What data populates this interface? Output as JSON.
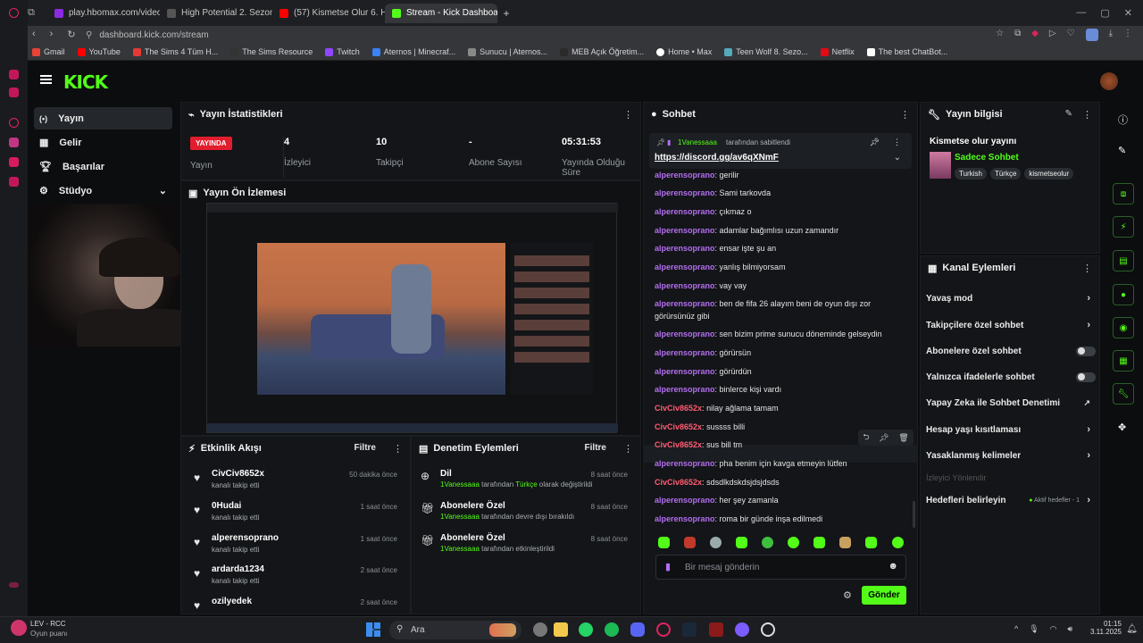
{
  "browser": {
    "tabs": [
      {
        "label": "play.hbomax.com/video/u",
        "color": "#8a2be2"
      },
      {
        "label": "High Potential 2. Sezon 7",
        "color": "#555"
      },
      {
        "label": "(57) Kismetse Olur 6. Ha",
        "color": "#ff0000"
      },
      {
        "label": "Stream - Kick Dashboard",
        "color": "#53fc18"
      }
    ],
    "url": "dashboard.kick.com/stream",
    "bookmarks": [
      "Gmail",
      "YouTube",
      "The Sims 4 Tüm H...",
      "The Sims Resource",
      "Twitch",
      "Aternos | Minecraf...",
      "Sunucu | Aternos...",
      "MEB Açık Öğretim...",
      "Home • Max",
      "Teen Wolf 8. Sezo...",
      "Netflix",
      "The best ChatBot..."
    ]
  },
  "kick": {
    "logo": "KICK",
    "nav": [
      {
        "label": "Yayın",
        "icon": "broadcast-icon"
      },
      {
        "label": "Gelir",
        "icon": "revenue-icon"
      },
      {
        "label": "Başarılar",
        "icon": "trophy-icon"
      },
      {
        "label": "Stüdyo",
        "icon": "studio-icon"
      }
    ]
  },
  "stats": {
    "title": "Yayın İstatistikleri",
    "live_badge": "YAYINDA",
    "live_label": "Yayın",
    "items": [
      {
        "value": "4",
        "label": "İzleyici"
      },
      {
        "value": "10",
        "label": "Takipçi"
      },
      {
        "value": "-",
        "label": "Abone Sayısı"
      },
      {
        "value": "05:31:53",
        "label": "Yayında Olduğu Süre"
      }
    ]
  },
  "preview": {
    "title": "Yayın Ön İzlemesi"
  },
  "activity": {
    "title": "Etkinlik Akışı",
    "filter": "Filtre",
    "items": [
      {
        "name": "CivCiv8652x",
        "sub": "kanalı takip etti",
        "time": "50 dakika önce"
      },
      {
        "name": "0Hudai",
        "sub": "kanalı takip etti",
        "time": "1 saat önce"
      },
      {
        "name": "alperensoprano",
        "sub": "kanalı takip etti",
        "time": "1 saat önce"
      },
      {
        "name": "ardarda1234",
        "sub": "kanalı takip etti",
        "time": "2 saat önce"
      },
      {
        "name": "ozilyedek",
        "sub": "",
        "time": "2 saat önce"
      }
    ]
  },
  "moderation": {
    "title": "Denetim Eylemleri",
    "filter": "Filtre",
    "items": [
      {
        "name": "Dil",
        "user": "1Vanessaaa",
        "mid": "tarafından",
        "hl": "Türkçe",
        "rest": "olarak değiştirildi",
        "time": "8 saat önce"
      },
      {
        "name": "Abonelere Özel",
        "user": "1Vanessaaa",
        "mid": "tarafından devre dışı bırakıldı",
        "hl": "",
        "rest": "",
        "time": "8 saat önce"
      },
      {
        "name": "Abonelere Özel",
        "user": "1Vanessaaa",
        "mid": "tarafından etkinleştirildi",
        "hl": "",
        "rest": "",
        "time": "8 saat önce"
      }
    ]
  },
  "chat": {
    "title": "Sohbet",
    "pinned_by": "1Vanessaaa",
    "pinned_suffix": "tarafından sabitlendi",
    "pinned_link": "https://discord.gg/av6qXNmF",
    "messages": [
      {
        "user": "alperensoprano",
        "text": "gerilir",
        "c": "u1"
      },
      {
        "user": "alperensoprano",
        "text": "Sami tarkovda",
        "c": "u1"
      },
      {
        "user": "alperensoprano",
        "text": "çıkmaz o",
        "c": "u1"
      },
      {
        "user": "alperensoprano",
        "text": "adamlar bağımlısı uzun zamandır",
        "c": "u1"
      },
      {
        "user": "alperensoprano",
        "text": "ensar işte şu an",
        "c": "u1"
      },
      {
        "user": "alperensoprano",
        "text": "yanlış bilmiyorsam",
        "c": "u1"
      },
      {
        "user": "alperensoprano",
        "text": "vay vay",
        "c": "u1"
      },
      {
        "user": "alperensoprano",
        "text": "ben de fifa 26 alayım beni de oyun dışı zor",
        "c": "u1"
      },
      {
        "user": "",
        "text": "görürsünüz gibi",
        "c": "u1"
      },
      {
        "user": "alperensoprano",
        "text": "sen bizim prime sunucu döneminde gelseydin",
        "c": "u1"
      },
      {
        "user": "alperensoprano",
        "text": "görürsün",
        "c": "u1"
      },
      {
        "user": "alperensoprano",
        "text": "görürdün",
        "c": "u1"
      },
      {
        "user": "alperensoprano",
        "text": "binlerce kişi vardı",
        "c": "u1"
      },
      {
        "user": "CivCiv8652x",
        "text": "nilay ağlama tamam",
        "c": "u2"
      },
      {
        "user": "CivCiv8652x",
        "text": "sussss billi",
        "c": "u2"
      },
      {
        "user": "CivCiv8652x",
        "text": "sus bill tm",
        "c": "u2"
      },
      {
        "user": "alperensoprano",
        "text": "pha benim için kavga etmeyin lütfen",
        "c": "u1"
      },
      {
        "user": "CivCiv8652x",
        "text": "sdsdlkdskdsjdsjdsds",
        "c": "u2"
      },
      {
        "user": "alperensoprano",
        "text": "her şey zamanla",
        "c": "u1"
      },
      {
        "user": "alperensoprano",
        "text": "roma bir günde inşa edilmedi",
        "c": "u1"
      }
    ],
    "input_placeholder": "Bir mesaj gönderin",
    "send": "Gönder"
  },
  "stream_info": {
    "title": "Yayın bilgisi",
    "stream_title": "Kismetse olur yayını",
    "category": "Sadece Sohbet",
    "tags": [
      "Turkish",
      "Türkçe",
      "kismetseolur"
    ]
  },
  "channel_actions": {
    "title": "Kanal Eylemleri",
    "rows": [
      {
        "label": "Yavaş mod",
        "kind": "chev"
      },
      {
        "label": "Takipçilere özel sohbet",
        "kind": "chev"
      },
      {
        "label": "Abonelere özel sohbet",
        "kind": "toggle"
      },
      {
        "label": "Yalnızca ifadelerle sohbet",
        "kind": "toggle"
      },
      {
        "label": "Yapay Zeka ile Sohbet Denetimi",
        "kind": "ext"
      },
      {
        "label": "Hesap yaşı kısıtlaması",
        "kind": "chev"
      },
      {
        "label": "Yasaklanmış kelimeler",
        "kind": "chev"
      }
    ],
    "disabled": "İzleyici Yönlendir",
    "goals": "Hedefleri belirleyin",
    "goals_badge": "Aktif hedefler - 1"
  },
  "taskbar": {
    "game": "LEV - RCC",
    "game_sub": "Oyun puanı",
    "search": "Ara",
    "time": "01:15",
    "date": "3.11.2025"
  },
  "colors": {
    "accent": "#53fc18",
    "live": "#e11d2e",
    "user1": "#b36ef0",
    "user2": "#ff5c72"
  }
}
